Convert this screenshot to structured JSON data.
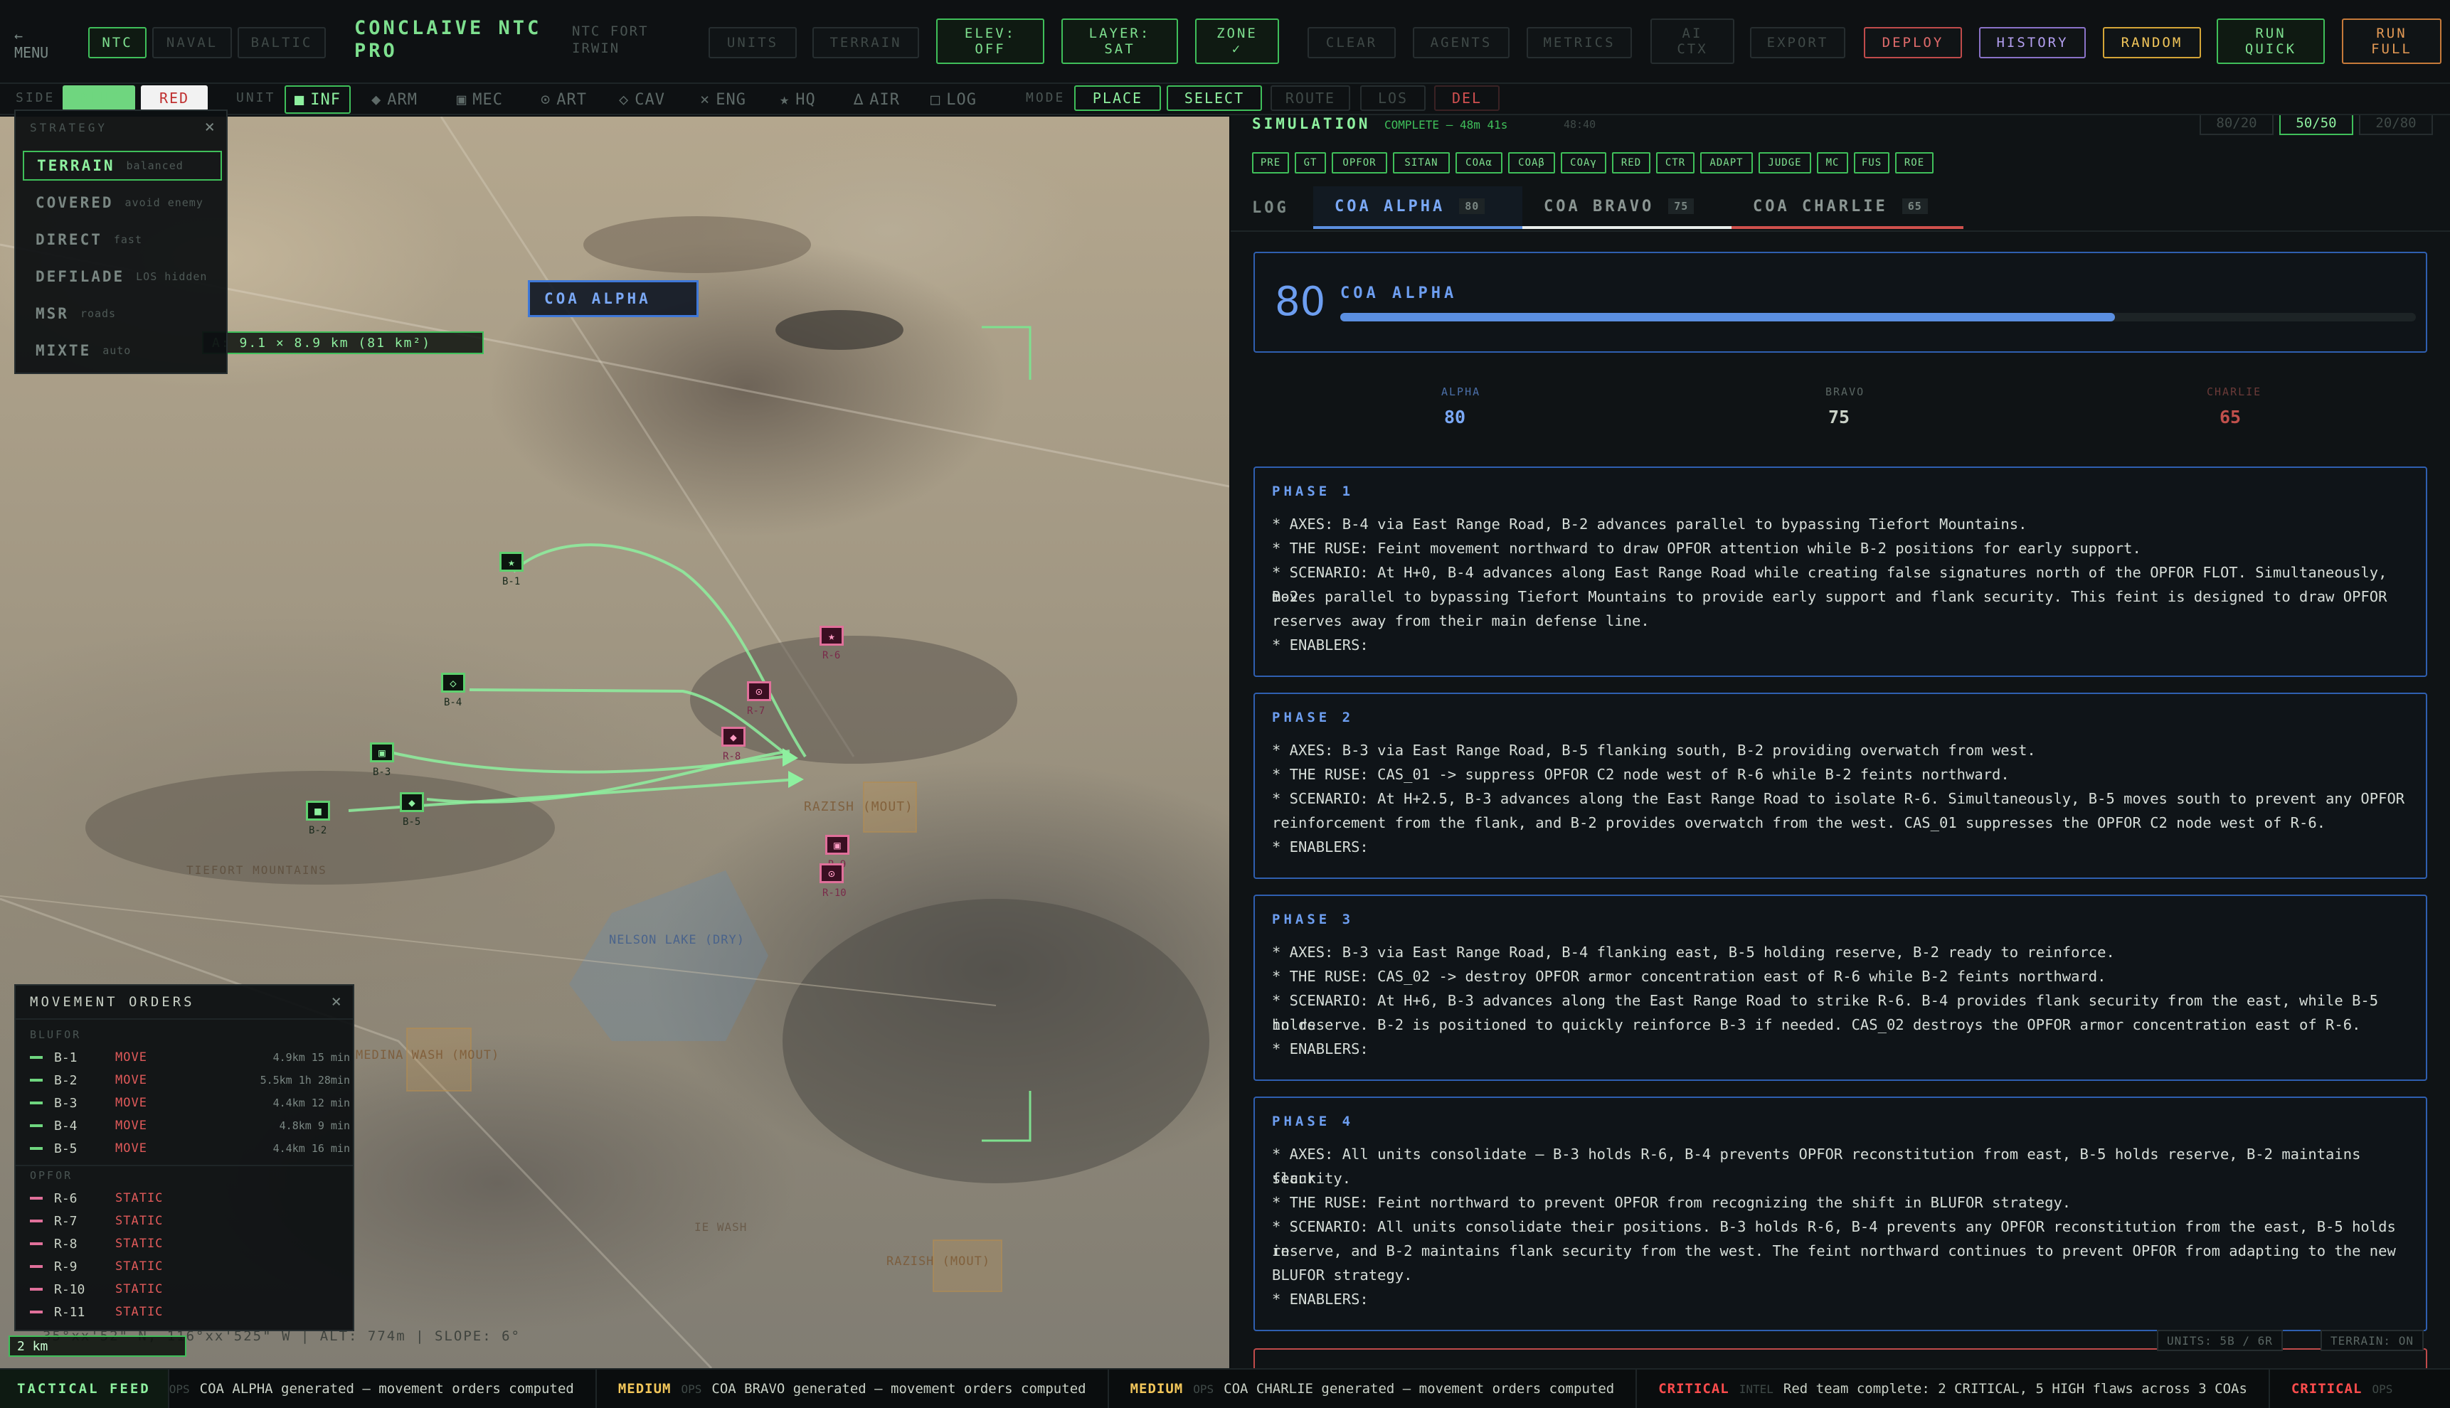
{
  "topbar": {
    "menu_arrow": "←",
    "menu_label": "MENU",
    "theater_tabs": [
      "NTC",
      "NAVAL",
      "BALTIC"
    ],
    "brand_line1": "CONCLAIVE NTC",
    "brand_line2": "PRO",
    "location_line1": "NTC FORT",
    "location_line2": "IRWIN",
    "units_btn": "UNITS",
    "terrain_btn": "TERRAIN",
    "elev_l1": "ELEV:",
    "elev_l2": "OFF",
    "layer_l1": "LAYER:",
    "layer_l2": "SAT",
    "zone_l1": "ZONE",
    "zone_l2": "✓",
    "clear_btn": "CLEAR",
    "agents_btn": "AGENTS",
    "metrics_btn": "METRICS",
    "ai_l1": "AI",
    "ai_l2": "CTX",
    "export_btn": "EXPORT",
    "deploy_btn": "DEPLOY",
    "history_btn": "HISTORY",
    "random_btn": "RANDOM",
    "runq_l1": "RUN",
    "runq_l2": "QUICK",
    "runf_l1": "RUN",
    "runf_l2": "FULL"
  },
  "toolrow": {
    "side_label": "SIDE",
    "side_blue": "BLUE",
    "side_red": "RED",
    "unit_label": "UNIT",
    "units": [
      {
        "icon": "■",
        "label": "INF"
      },
      {
        "icon": "◆",
        "label": "ARM"
      },
      {
        "icon": "▣",
        "label": "MEC"
      },
      {
        "icon": "⊙",
        "label": "ART"
      },
      {
        "icon": "◇",
        "label": "CAV"
      },
      {
        "icon": "⨯",
        "label": "ENG"
      },
      {
        "icon": "★",
        "label": "HQ"
      },
      {
        "icon": "∆",
        "label": "AIR"
      },
      {
        "icon": "□",
        "label": "LOG"
      }
    ],
    "mode_label": "MODE",
    "modes": [
      "PLACE",
      "SELECT",
      "ROUTE",
      "LOS",
      "DEL"
    ]
  },
  "strategy": {
    "title": "STRATEGY",
    "close": "×",
    "items": [
      {
        "name": "TERRAIN",
        "sub": "balanced"
      },
      {
        "name": "COVERED",
        "sub": "avoid enemy"
      },
      {
        "name": "DIRECT",
        "sub": "fast"
      },
      {
        "name": "DEFILADE",
        "sub": "LOS hidden"
      },
      {
        "name": "MSR",
        "sub": "roads"
      },
      {
        "name": "MIXTE",
        "sub": "auto"
      }
    ]
  },
  "map": {
    "coa_label": "COA ALPHA",
    "area_readout": "A: 9.1 × 8.9 km (81 km²)",
    "places": [
      "TIEFORT MOUNTAINS",
      "RAZISH (MOUT)",
      "NELSON LAKE (DRY)",
      "MEDINA WASH (MOUT)",
      "RAZISH (MOUT)"
    ],
    "place_extra": "IE WASH",
    "coords": "35°xx'52\" N, 116°xx'525\" W | ALT: 774m | SLOPE: 6°",
    "scale": "2 km",
    "units_status": "UNITS: 5B / 6R",
    "terrain_status": "TERRAIN: ON",
    "blue_units": [
      {
        "id": "B-1",
        "icon": "★"
      },
      {
        "id": "B-4",
        "icon": "◇"
      },
      {
        "id": "B-3",
        "icon": "▣"
      },
      {
        "id": "B-5",
        "icon": "◆"
      },
      {
        "id": "B-2",
        "icon": "■"
      }
    ],
    "red_units": [
      {
        "id": "R-6",
        "icon": "★"
      },
      {
        "id": "R-7",
        "icon": "⊙"
      },
      {
        "id": "R-8",
        "icon": "◆"
      },
      {
        "id": "R-9",
        "icon": "▣"
      },
      {
        "id": "R-10",
        "icon": "⊙"
      }
    ]
  },
  "orders": {
    "title": "MOVEMENT ORDERS",
    "close": "×",
    "blufor_label": "BLUFOR",
    "opfor_label": "OPFOR",
    "blufor": [
      {
        "id": "B-1",
        "action": "MOVE",
        "dist": "4.9km 15 min"
      },
      {
        "id": "B-2",
        "action": "MOVE",
        "dist": "5.5km 1h 28min"
      },
      {
        "id": "B-3",
        "action": "MOVE",
        "dist": "4.4km 12 min"
      },
      {
        "id": "B-4",
        "action": "MOVE",
        "dist": "4.8km 9 min"
      },
      {
        "id": "B-5",
        "action": "MOVE",
        "dist": "4.4km 16 min"
      }
    ],
    "opfor": [
      {
        "id": "R-6",
        "action": "STATIC"
      },
      {
        "id": "R-7",
        "action": "STATIC"
      },
      {
        "id": "R-8",
        "action": "STATIC"
      },
      {
        "id": "R-9",
        "action": "STATIC"
      },
      {
        "id": "R-10",
        "action": "STATIC"
      },
      {
        "id": "R-11",
        "action": "STATIC"
      }
    ]
  },
  "right": {
    "sim_label": "SIMULATION",
    "sim_status": "COMPLETE — 48m 41s",
    "sim_extra": "48:40",
    "split_options": [
      "80/20",
      "50/50",
      "20/80"
    ],
    "chips": [
      "PRE",
      "GT",
      "OPFOR",
      "SITAN",
      "COAα",
      "COAβ",
      "COAγ",
      "RED",
      "CTR",
      "ADAPT",
      "JUDGE",
      "MC",
      "FUS",
      "ROE"
    ],
    "tabs": [
      {
        "label": "LOG",
        "count": ""
      },
      {
        "label": "COA ALPHA",
        "count": "80"
      },
      {
        "label": "COA BRAVO",
        "count": "75"
      },
      {
        "label": "COA CHARLIE",
        "count": "65"
      }
    ],
    "score": "80",
    "score_title": "COA ALPHA",
    "score_fraction": 0.8,
    "compare": [
      {
        "label": "ALPHA",
        "value": "80"
      },
      {
        "label": "BRAVO",
        "value": "75"
      },
      {
        "label": "CHARLIE",
        "value": "65"
      }
    ],
    "phases": [
      {
        "title": "PHASE 1",
        "lines": [
          "* AXES: B-4 via East Range Road, B-2 advances parallel to bypassing Tiefort Mountains.",
          "  * THE RUSE: Feint movement northward to draw OPFOR attention while B-2 positions for early support.",
          "  * SCENARIO: At H+0, B-4 advances along East Range Road while creating false signatures north of the OPFOR FLOT. Simultaneously, B-2",
          "moves parallel to bypassing Tiefort Mountains to provide early support and flank security. This feint is designed to draw OPFOR",
          "reserves away from their main defense line.",
          "  * ENABLERS:"
        ]
      },
      {
        "title": "PHASE 2",
        "lines": [
          "* AXES: B-3 via East Range Road, B-5 flanking south, B-2 providing overwatch from west.",
          "  * THE RUSE: CAS_01 -> suppress OPFOR C2 node west of R-6 while B-2 feints northward.",
          "  * SCENARIO: At H+2.5, B-3 advances along the East Range Road to isolate R-6. Simultaneously, B-5 moves south to prevent any OPFOR",
          "reinforcement from the flank, and B-2 provides overwatch from the west. CAS_01 suppresses the OPFOR C2 node west of R-6.",
          "  * ENABLERS:"
        ]
      },
      {
        "title": "PHASE 3",
        "lines": [
          "* AXES: B-3 via East Range Road, B-4 flanking east, B-5 holding reserve, B-2 ready to reinforce.",
          "  * THE RUSE: CAS_02 -> destroy OPFOR armor concentration east of R-6 while B-2 feints northward.",
          "  * SCENARIO: At H+6, B-3 advances along the East Range Road to strike R-6. B-4 provides flank security from the east, while B-5 holds",
          "in reserve. B-2 is positioned to quickly reinforce B-3 if needed. CAS_02 destroys the OPFOR armor concentration east of R-6.",
          "  * ENABLERS:"
        ]
      },
      {
        "title": "PHASE 4",
        "lines": [
          "* AXES: All units consolidate — B-3 holds R-6, B-4 prevents OPFOR reconstitution from east, B-5 holds reserve, B-2 maintains flank",
          "security.",
          "  * THE RUSE: Feint northward to prevent OPFOR from recognizing the shift in BLUFOR strategy.",
          "  * SCENARIO: All units consolidate their positions. B-3 holds R-6, B-4 prevents any OPFOR reconstitution from the east, B-5 holds in",
          "reserve, and B-2 maintains flank security from the west. The feint northward continues to prevent OPFOR from adapting to the new",
          "BLUFOR strategy.",
          "  * ENABLERS:"
        ]
      }
    ]
  },
  "feed": {
    "label": "TACTICAL FEED",
    "ops": "OPS",
    "intel": "INTEL",
    "items": [
      {
        "level": "",
        "tag": "OPS",
        "text": "COA ALPHA generated — movement orders computed"
      },
      {
        "level": "MEDIUM",
        "tag": "OPS",
        "text": "COA BRAVO generated — movement orders computed"
      },
      {
        "level": "MEDIUM",
        "tag": "OPS",
        "text": "COA CHARLIE generated — movement orders computed"
      },
      {
        "level": "CRITICAL",
        "tag": "INTEL",
        "text": "Red team complete: 2 CRITICAL, 5 HIGH flaws across 3 COAs"
      },
      {
        "level": "CRITICAL",
        "tag": "OPS",
        "text": ""
      }
    ]
  },
  "colors": {
    "accent_green": "#3fbf5a",
    "alpha_blue": "#6d9ef0",
    "bravo_white": "#e8ecea",
    "charlie_red": "#d0504c",
    "critical": "#ff4d4d",
    "medium": "#f2c65a"
  }
}
